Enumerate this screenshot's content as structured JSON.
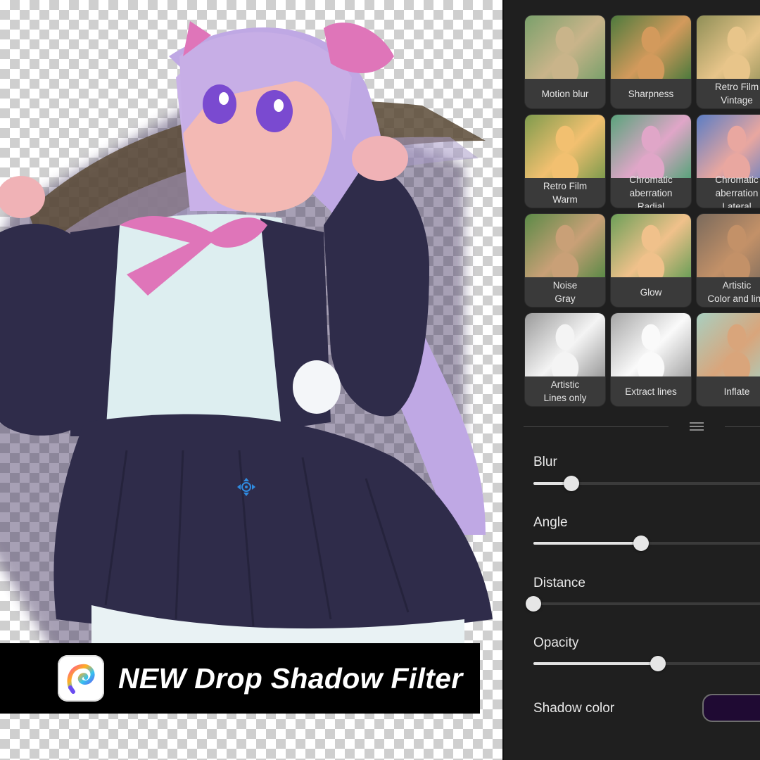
{
  "banner": {
    "title": "NEW Drop Shadow Filter",
    "logo_icon": "pen-p-logo-icon"
  },
  "filters": [
    {
      "label": "Motion blur",
      "tone": [
        "#c9b48a",
        "#7aa06b"
      ]
    },
    {
      "label": "Sharpness",
      "tone": [
        "#d39a5c",
        "#4d7a3d"
      ]
    },
    {
      "label": "Retro Film\nVintage",
      "tone": [
        "#e8c58a",
        "#8f8f57"
      ]
    },
    {
      "label": "Retro Film\nWarm",
      "tone": [
        "#f2c070",
        "#7e9b4d"
      ]
    },
    {
      "label": "Chromatic\naberration\nRadial",
      "tone": [
        "#e0a6c8",
        "#59a37b"
      ]
    },
    {
      "label": "Chromatic\naberration\nLateral",
      "tone": [
        "#e9a7a0",
        "#5b7dc4"
      ]
    },
    {
      "label": "Noise\nGray",
      "tone": [
        "#c9a077",
        "#5b8a47"
      ]
    },
    {
      "label": "Glow",
      "tone": [
        "#f0c18b",
        "#6c9f58"
      ]
    },
    {
      "label": "Artistic\nColor and line",
      "tone": [
        "#c39168",
        "#7a6a5c"
      ]
    },
    {
      "label": "Artistic\nLines only",
      "tone": [
        "#f4f4f4",
        "#9a9a9a"
      ]
    },
    {
      "label": "Extract lines",
      "tone": [
        "#fafafa",
        "#a6a6a6"
      ]
    },
    {
      "label": "Inflate",
      "tone": [
        "#d9a57b",
        "#a8cfc0"
      ]
    }
  ],
  "controls": {
    "blur": {
      "label": "Blur",
      "value": 0.16
    },
    "angle": {
      "label": "Angle",
      "value": 0.45
    },
    "distance": {
      "label": "Distance",
      "value": 0.0
    },
    "opacity": {
      "label": "Opacity",
      "value": 0.52
    },
    "shadow_color": {
      "label": "Shadow color",
      "value": "#1f0a33"
    }
  },
  "colors": {
    "panel_bg": "#1f1f1f",
    "accent": "#e2e2e2",
    "skirt": "#2f2c4a",
    "hair": "#c9b1e8",
    "ribbon": "#df75b9"
  }
}
